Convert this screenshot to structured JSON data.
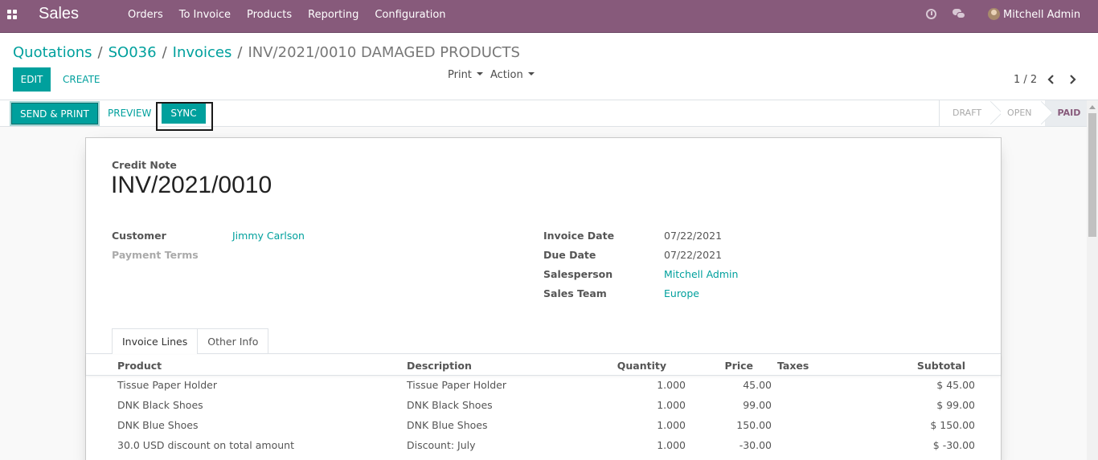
{
  "navbar": {
    "app_name": "Sales",
    "menu": [
      "Orders",
      "To Invoice",
      "Products",
      "Reporting",
      "Configuration"
    ],
    "user": "Mitchell Admin",
    "icons": [
      "apps-icon",
      "clock-icon",
      "chat-icon",
      "avatar"
    ]
  },
  "breadcrumb": {
    "items": [
      "Quotations",
      "SO036",
      "Invoices"
    ],
    "separator": "/",
    "current": "INV/2021/0010 DAMAGED PRODUCTS"
  },
  "control": {
    "edit": "EDIT",
    "create": "CREATE",
    "print": "Print",
    "action": "Action",
    "pager": "1 / 2"
  },
  "statusbar": {
    "send_print": "SEND & PRINT",
    "preview": "PREVIEW",
    "sync": "SYNC",
    "stages": [
      "DRAFT",
      "OPEN",
      "PAID"
    ],
    "active_stage": "PAID"
  },
  "document": {
    "type": "Credit Note",
    "number": "INV/2021/0010",
    "left_fields": [
      {
        "label": "Customer",
        "value": "Jimmy Carlson"
      },
      {
        "label": "Payment Terms",
        "value": ""
      }
    ],
    "right_fields": [
      {
        "label": "Invoice Date",
        "value": "07/22/2021"
      },
      {
        "label": "Due Date",
        "value": "07/22/2021"
      },
      {
        "label": "Salesperson",
        "value": "Mitchell Admin"
      },
      {
        "label": "Sales Team",
        "value": "Europe"
      }
    ]
  },
  "tabs": [
    "Invoice Lines",
    "Other Info"
  ],
  "lines": {
    "columns": [
      "Product",
      "Description",
      "Quantity",
      "Price",
      "Taxes",
      "Subtotal"
    ],
    "rows": [
      {
        "product": "Tissue Paper Holder",
        "description": "Tissue Paper Holder",
        "quantity": "1.000",
        "price": "45.00",
        "taxes": "",
        "subtotal": "$ 45.00"
      },
      {
        "product": "DNK Black Shoes",
        "description": "DNK Black Shoes",
        "quantity": "1.000",
        "price": "99.00",
        "taxes": "",
        "subtotal": "$ 99.00"
      },
      {
        "product": "DNK Blue Shoes",
        "description": "DNK Blue Shoes",
        "quantity": "1.000",
        "price": "150.00",
        "taxes": "",
        "subtotal": "$ 150.00"
      },
      {
        "product": "30.0 USD discount on total amount",
        "description": "Discount: July",
        "quantity": "1.000",
        "price": "-30.00",
        "taxes": "",
        "subtotal": "$ -30.00"
      }
    ]
  },
  "colors": {
    "navbar": "#875a7b",
    "primary": "#00a09d",
    "active_stage": "#875a7b"
  }
}
